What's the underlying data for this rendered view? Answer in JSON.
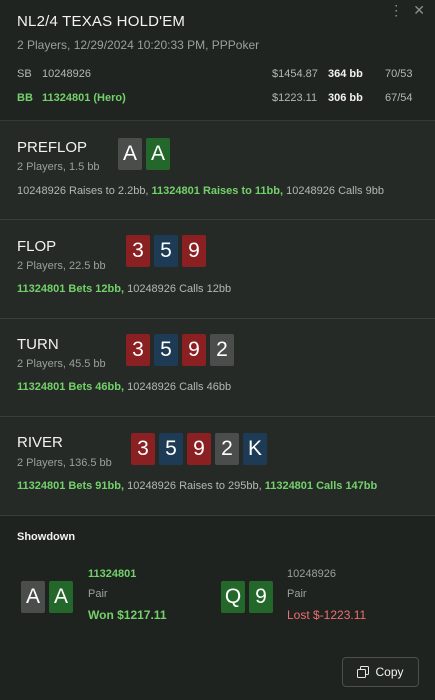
{
  "header": {
    "title": "NL2/4 TEXAS HOLD'EM",
    "subtitle": "2 Players, 12/29/2024 10:20:33 PM, PPPoker",
    "players": [
      {
        "pos": "SB",
        "id": "10248926",
        "stack": "$1454.87",
        "bb": "364 bb",
        "stat": "70/53"
      },
      {
        "pos": "BB",
        "id": "11324801 (Hero)",
        "stack": "$1223.11",
        "bb": "306 bb",
        "stat": "67/54"
      }
    ]
  },
  "streets": {
    "preflop": {
      "name": "PREFLOP",
      "info": "2 Players, 1.5 bb",
      "cards": [
        {
          "rank": "A",
          "suit": "spades"
        },
        {
          "rank": "A",
          "suit": "clubs"
        }
      ],
      "actions": [
        {
          "text": "10248926 Raises to 2.2bb, ",
          "hero": false
        },
        {
          "text": "11324801 Raises to 11bb,",
          "hero": true
        },
        {
          "text": " 10248926 Calls 9bb",
          "hero": false
        }
      ]
    },
    "flop": {
      "name": "FLOP",
      "info": "2 Players, 22.5 bb",
      "cards": [
        {
          "rank": "3",
          "suit": "hearts"
        },
        {
          "rank": "5",
          "suit": "diamonds"
        },
        {
          "rank": "9",
          "suit": "hearts"
        }
      ],
      "actions": [
        {
          "text": "11324801 Bets 12bb,",
          "hero": true
        },
        {
          "text": " 10248926 Calls 12bb",
          "hero": false
        }
      ]
    },
    "turn": {
      "name": "TURN",
      "info": "2 Players, 45.5 bb",
      "cards": [
        {
          "rank": "3",
          "suit": "hearts"
        },
        {
          "rank": "5",
          "suit": "diamonds"
        },
        {
          "rank": "9",
          "suit": "hearts"
        },
        {
          "rank": "2",
          "suit": "spades"
        }
      ],
      "actions": [
        {
          "text": "11324801 Bets 46bb,",
          "hero": true
        },
        {
          "text": " 10248926 Calls 46bb",
          "hero": false
        }
      ]
    },
    "river": {
      "name": "RIVER",
      "info": "2 Players, 136.5 bb",
      "cards": [
        {
          "rank": "3",
          "suit": "hearts"
        },
        {
          "rank": "5",
          "suit": "diamonds"
        },
        {
          "rank": "9",
          "suit": "hearts"
        },
        {
          "rank": "2",
          "suit": "spades"
        },
        {
          "rank": "K",
          "suit": "diamonds"
        }
      ],
      "actions": [
        {
          "text": "11324801 Bets 91bb,",
          "hero": true
        },
        {
          "text": " 10248926 Raises to 295bb, ",
          "hero": false
        },
        {
          "text": "11324801 Calls 147bb",
          "hero": true
        }
      ]
    }
  },
  "showdown": {
    "title": "Showdown",
    "hero": {
      "id": "11324801",
      "hand": "Pair",
      "result": "Won $1217.11",
      "cards": [
        {
          "rank": "A",
          "suit": "spades"
        },
        {
          "rank": "A",
          "suit": "clubs"
        }
      ]
    },
    "villain": {
      "id": "10248926",
      "hand": "Pair",
      "result": "Lost $-1223.11",
      "cards": [
        {
          "rank": "Q",
          "suit": "clubs"
        },
        {
          "rank": "9",
          "suit": "clubs"
        }
      ]
    }
  },
  "copy_label": "Copy",
  "colors": {
    "hero": "#73d16a",
    "lost": "#ee6f6f",
    "spades": "#4a4d4b",
    "clubs": "#23682a",
    "hearts": "#8a2022",
    "diamonds": "#1e3b56"
  }
}
